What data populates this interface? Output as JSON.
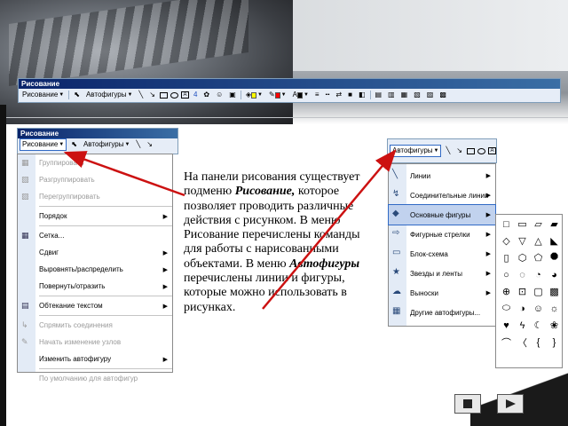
{
  "top_toolbar": {
    "title": "Рисование",
    "menu_label": "Рисование",
    "autoshapes_label": "Автофигуры",
    "fill_colors": [
      "#ffff00",
      "#ff0000",
      "#000000"
    ]
  },
  "left_toolbar": {
    "title": "Рисование",
    "menu_label": "Рисование",
    "autoshapes_label": "Автофигуры"
  },
  "drawing_menu": {
    "items": [
      {
        "label": "Группировать",
        "disabled": true,
        "submenu": false
      },
      {
        "label": "Разгруппировать",
        "disabled": true,
        "submenu": false
      },
      {
        "label": "Перегруппировать",
        "disabled": true,
        "submenu": false
      },
      {
        "label": "Порядок",
        "disabled": false,
        "submenu": true
      },
      {
        "label": "Сетка...",
        "disabled": false,
        "submenu": false
      },
      {
        "label": "Сдвиг",
        "disabled": false,
        "submenu": true
      },
      {
        "label": "Выровнять/распределить",
        "disabled": false,
        "submenu": true
      },
      {
        "label": "Повернуть/отразить",
        "disabled": false,
        "submenu": true
      },
      {
        "label": "Обтекание текстом",
        "disabled": false,
        "submenu": true
      },
      {
        "label": "Спрямить соединения",
        "disabled": true,
        "submenu": false
      },
      {
        "label": "Начать изменение узлов",
        "disabled": true,
        "submenu": false
      },
      {
        "label": "Изменить автофигуру",
        "disabled": false,
        "submenu": true
      },
      {
        "label": "По умолчанию для автофигур",
        "disabled": true,
        "submenu": false
      }
    ]
  },
  "right_toolbar": {
    "autoshapes_label": "Автофигуры"
  },
  "autoshapes_menu": {
    "items": [
      {
        "label": "Линии",
        "submenu": true
      },
      {
        "label": "Соединительные линии",
        "submenu": true
      },
      {
        "label": "Основные фигуры",
        "submenu": true,
        "highlighted": true
      },
      {
        "label": "Фигурные стрелки",
        "submenu": true
      },
      {
        "label": "Блок-схема",
        "submenu": true
      },
      {
        "label": "Звезды и ленты",
        "submenu": true
      },
      {
        "label": "Выноски",
        "submenu": true
      },
      {
        "label": "Другие автофигуры...",
        "submenu": false
      }
    ]
  },
  "basic_shapes": {
    "count": 32
  },
  "description": {
    "part1": "На панели рисования существует подменю ",
    "term1": "Рисование,",
    "part2": " которое позволяет проводить различные действия с рисунком. В меню Рисование перечислены команды для работы с нарисованными объектами. В меню ",
    "term2": "Автофигуры",
    "part3": " перечислены линии и фигуры, которые можно использовать в рисунках."
  },
  "colors": {
    "arrow": "#cc1111",
    "toolbar_bg": "#e6edf7",
    "highlight": "#c1d2ee"
  }
}
